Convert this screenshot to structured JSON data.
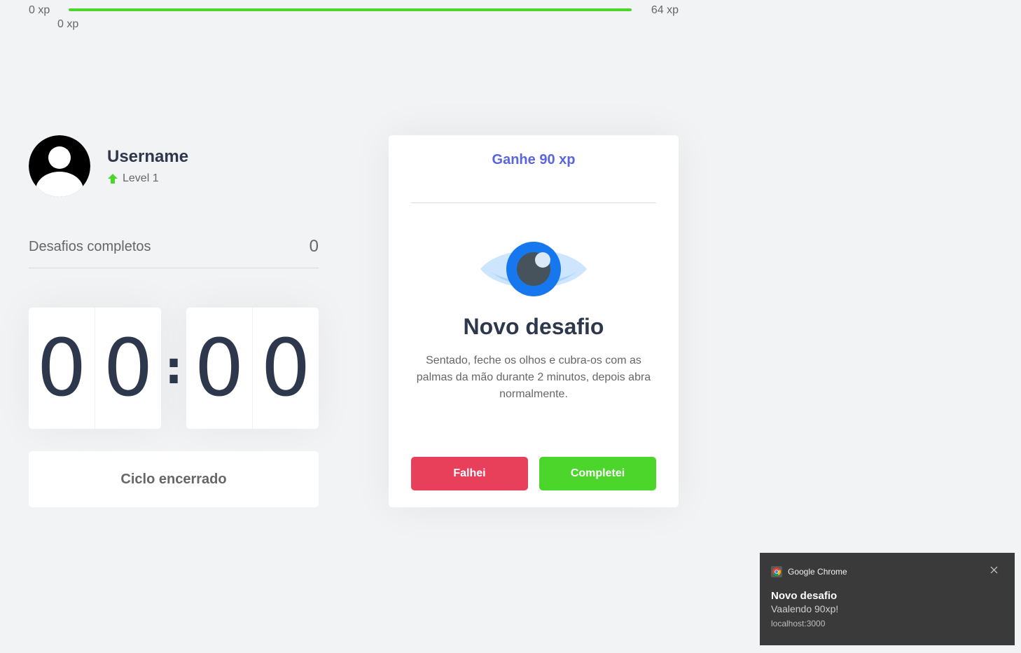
{
  "xp": {
    "min_label": "0 xp",
    "max_label": "64 xp",
    "current_label": "0 xp",
    "progress_fraction": 1.0,
    "bar_color": "#4cd62b"
  },
  "profile": {
    "username": "Username",
    "level": "Level 1",
    "avatar_icon": "user-avatar-icon",
    "level_icon": "level-up-arrow-icon"
  },
  "completed": {
    "label": "Desafios completos",
    "count": "0"
  },
  "countdown": {
    "minute_left": "0",
    "minute_right": "0",
    "separator": ":",
    "second_left": "0",
    "second_right": "0",
    "cycle_button_label": "Ciclo encerrado"
  },
  "challenge": {
    "header": "Ganhe 90 xp",
    "icon": "eye-icon",
    "title": "Novo desafio",
    "description": "Sentado, feche os olhos e cubra-os com as palmas da mão durante 2 minutos, depois abra normalmente.",
    "fail_label": "Falhei",
    "complete_label": "Completei",
    "accent_color": "#5965e0",
    "fail_color": "#e83f5b",
    "complete_color": "#4cd62b"
  },
  "notification": {
    "app": "Google Chrome",
    "title": "Novo desafio",
    "body": "Vaalendo 90xp!",
    "origin": "localhost:3000"
  }
}
